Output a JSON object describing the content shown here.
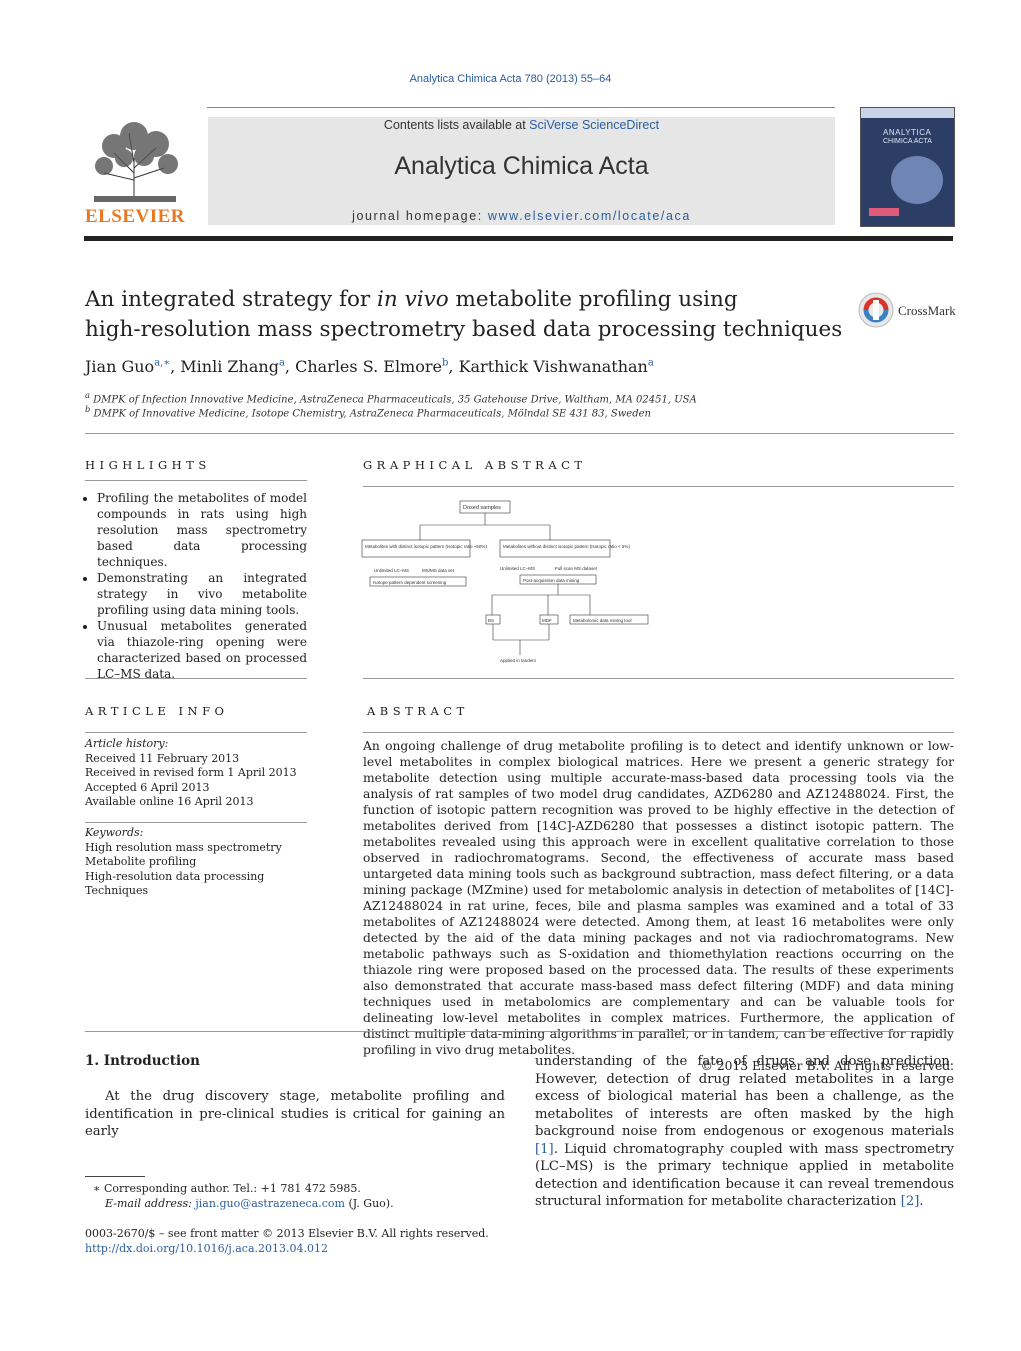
{
  "header": {
    "journal_citation": "Analytica Chimica Acta 780 (2013) 55–64",
    "contents_prefix": "Contents lists available at ",
    "contents_link": "SciVerse ScienceDirect",
    "journal_title": "Analytica Chimica Acta",
    "homepage_prefix": "journal homepage: ",
    "homepage_link": "www.elsevier.com/locate/aca",
    "publisher": "ELSEVIER",
    "cover_title_1": "ANALYTICA",
    "cover_title_2": "CHIMICA ACTA",
    "crossmark_label": "CrossMark"
  },
  "article": {
    "title_part1": "An integrated strategy for ",
    "title_italic": "in vivo",
    "title_part2": " metabolite profiling using",
    "title_line2": "high-resolution mass spectrometry based data processing techniques",
    "authors": [
      {
        "name": "Jian Guo",
        "sup": "a,∗"
      },
      {
        "name": "Minli Zhang",
        "sup": "a"
      },
      {
        "name": "Charles S. Elmore",
        "sup": "b"
      },
      {
        "name": "Karthick Vishwanathan",
        "sup": "a"
      }
    ],
    "affiliations": [
      {
        "mark": "a",
        "text": "DMPK of Infection Innovative Medicine, AstraZeneca Pharmaceuticals, 35 Gatehouse Drive, Waltham, MA 02451, USA"
      },
      {
        "mark": "b",
        "text": "DMPK of Innovative Medicine, Isotope Chemistry, AstraZeneca Pharmaceuticals, Mölndal SE 431 83, Sweden"
      }
    ]
  },
  "highlights": {
    "heading": "Highlights",
    "items": [
      "Profiling the metabolites of model compounds in rats using high resolution mass spectrometry based data processing techniques.",
      "Demonstrating an integrated strategy in vivo metabolite profiling using data mining tools.",
      "Unusual metabolites generated via thiazole-ring opening were characterized based on processed LC–MS data."
    ]
  },
  "graphical_abstract": {
    "heading": "Graphical abstract",
    "nodes": {
      "top": "Dosed samples",
      "left": "Metabolites with distinct isotopic pattern (Isotopic ratio ~50%)",
      "right": "Metabolites without distinct isotopic pattern (Isotopic ratio < 5%)",
      "left_a": "Unlimited LC–MS",
      "left_b": "MS/MS data set",
      "left_c": "Isotope pattern dependent screening",
      "right_a": "Unlimited LC–MS",
      "right_b": "Full scan MS dataset",
      "right_c": "Post-acquisition data mining",
      "bs": "BS",
      "mdf": "MDF",
      "tool": "Metabolomic data mining tool",
      "bottom": "Applied in tandem"
    }
  },
  "article_info": {
    "heading": "Article info",
    "history_label": "Article history:",
    "history": [
      "Received 11 February 2013",
      "Received in revised form 1 April 2013",
      "Accepted 6 April 2013",
      "Available online 16 April 2013"
    ],
    "keywords_label": "Keywords:",
    "keywords": [
      "High resolution mass spectrometry",
      "Metabolite profiling",
      "High-resolution data processing",
      "Techniques"
    ]
  },
  "abstract": {
    "heading": "Abstract",
    "text": "An ongoing challenge of drug metabolite profiling is to detect and identify unknown or low-level metabolites in complex biological matrices. Here we present a generic strategy for metabolite detection using multiple accurate-mass-based data processing tools via the analysis of rat samples of two model drug candidates, AZD6280 and AZ12488024. First, the function of isotopic pattern recognition was proved to be highly effective in the detection of metabolites derived from [14C]-AZD6280 that possesses a distinct isotopic pattern. The metabolites revealed using this approach were in excellent qualitative correlation to those observed in radiochromatograms. Second, the effectiveness of accurate mass based untargeted data mining tools such as background subtraction, mass defect filtering, or a data mining package (MZmine) used for metabolomic analysis in detection of metabolites of [14C]-AZ12488024 in rat urine, feces, bile and plasma samples was examined and a total of 33 metabolites of AZ12488024 were detected. Among them, at least 16 metabolites were only detected by the aid of the data mining packages and not via radiochromatograms. New metabolic pathways such as S-oxidation and thiomethylation reactions occurring on the thiazole ring were proposed based on the processed data. The results of these experiments also demonstrated that accurate mass-based mass defect filtering (MDF) and data mining techniques used in metabolomics are complementary and can be valuable tools for delineating low-level metabolites in complex matrices. Furthermore, the application of distinct multiple data-mining algorithms in parallel, or in tandem, can be effective for rapidly profiling in vivo drug metabolites.",
    "copyright": "© 2013 Elsevier B.V. All rights reserved."
  },
  "introduction": {
    "heading": "1.  Introduction",
    "col1": "At the drug discovery stage, metabolite profiling and identification in pre-clinical studies is critical for gaining an early",
    "col2_a": "understanding of the fate of drugs and dose prediction. However, detection of drug related metabolites in a large excess of biological material has been a challenge, as the metabolites of interests are often masked by the high background noise from endogenous or exogenous materials ",
    "ref1": "[1]",
    "col2_b": ". Liquid chromatography coupled with mass spectrometry (LC–MS) is the primary technique applied in metabolite detection and identification because it can reveal tremendous structural information for metabolite characterization ",
    "ref2": "[2]",
    "col2_c": "."
  },
  "footnotes": {
    "corresponding": "∗ Corresponding author. Tel.: +1 781 472 5985.",
    "email_label": "E-mail address: ",
    "email": "jian.guo@astrazeneca.com",
    "email_suffix": " (J. Guo).",
    "issn": "0003-2670/$ – see front matter © 2013 Elsevier B.V. All rights reserved.",
    "doi": "http://dx.doi.org/10.1016/j.aca.2013.04.012"
  }
}
